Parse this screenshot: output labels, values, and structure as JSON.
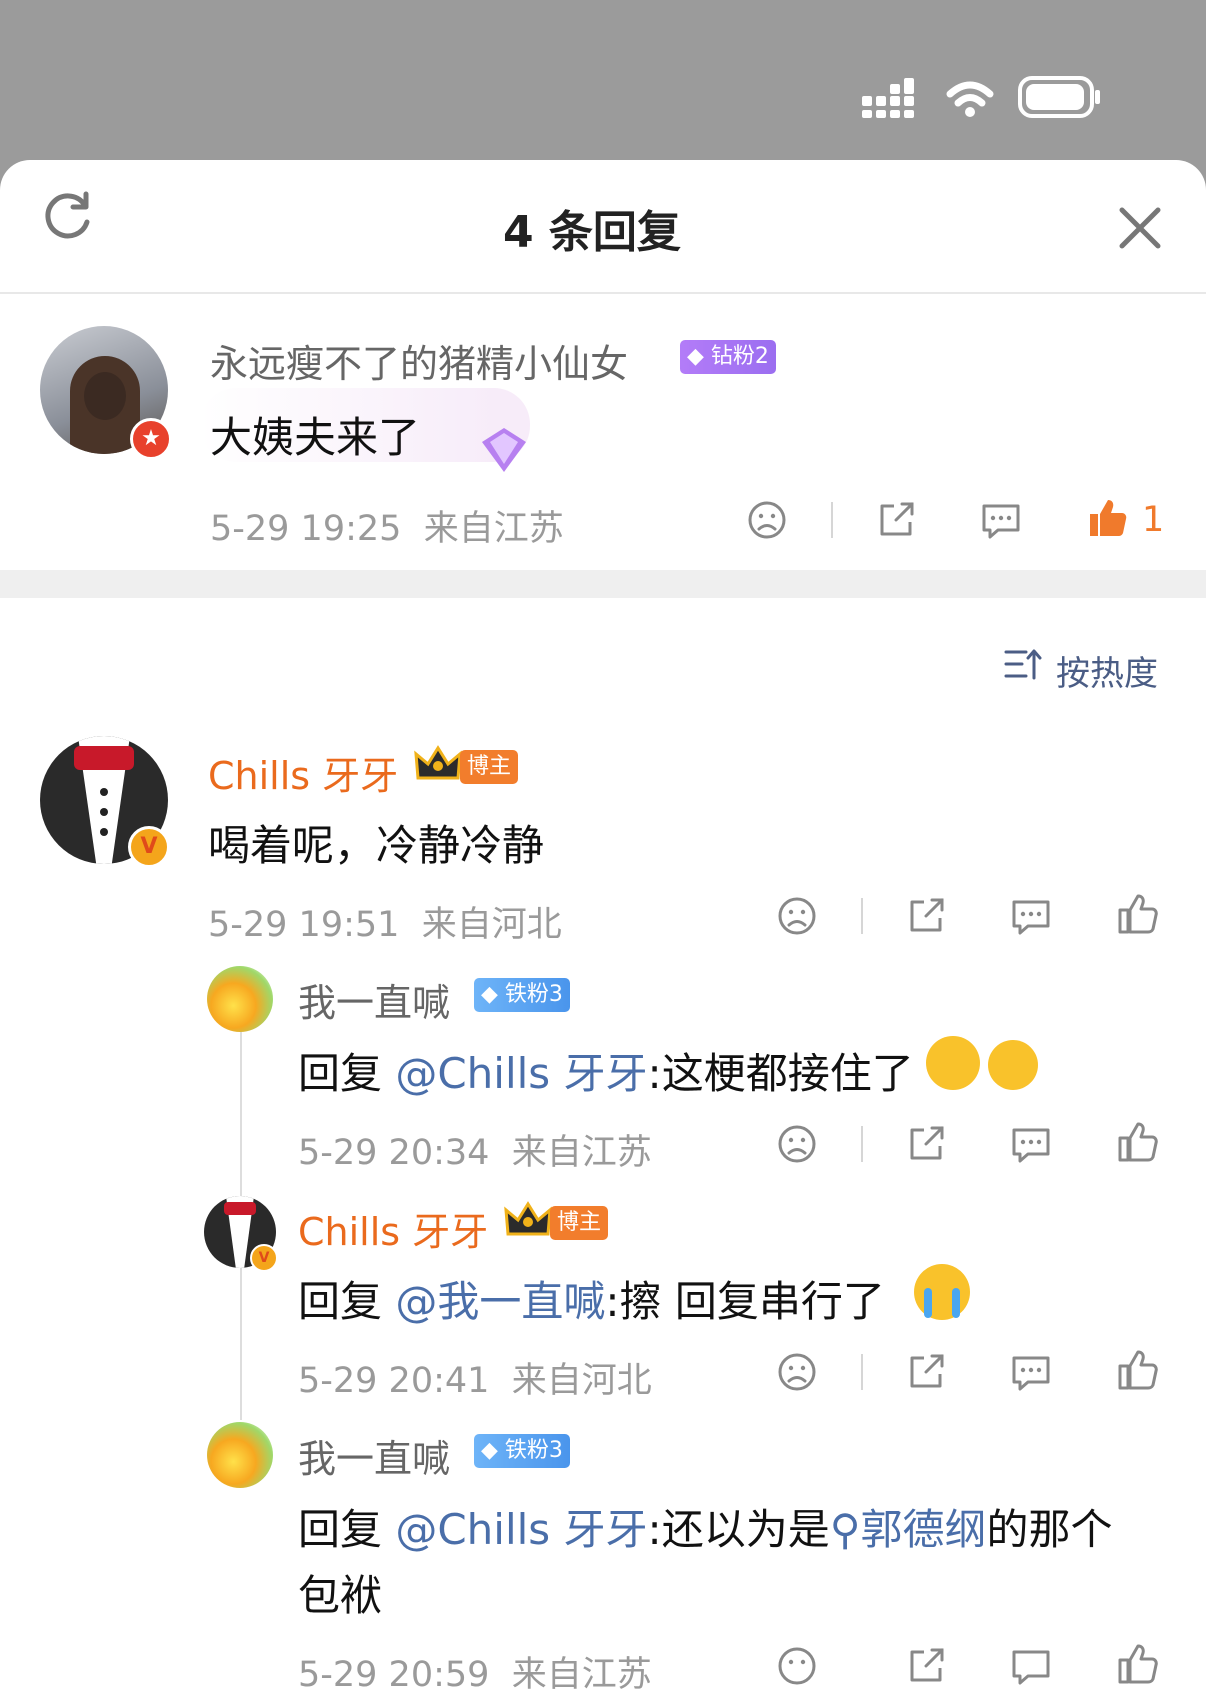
{
  "status_bar": {
    "signal_icon": "signal-icon",
    "wifi_icon": "wifi-icon",
    "battery_icon": "battery-icon"
  },
  "header": {
    "title": "4 条回复",
    "refresh_icon": "refresh-icon",
    "close_icon": "close-icon"
  },
  "main_comment": {
    "username": "永远瘦不了的猪精小仙女",
    "badge": "钻粉2",
    "text": "大姨夫来了",
    "time": "5-29 19:25",
    "location": "来自江苏",
    "like_count": "1"
  },
  "sort": {
    "label": "按热度"
  },
  "replies": [
    {
      "username": "Chills 牙牙",
      "badge": "博主",
      "text": "喝着呢，冷静冷静",
      "time": "5-29 19:51",
      "location": "来自河北"
    },
    {
      "username": "我一直喊",
      "badge": "铁粉3",
      "reply_prefix": "回复 ",
      "mention": "@Chills 牙牙",
      "text": ":这梗都接住了",
      "time": "5-29 20:34",
      "location": "来自江苏"
    },
    {
      "username": "Chills 牙牙",
      "badge": "博主",
      "reply_prefix": "回复 ",
      "mention": "@我一直喊",
      "text": ":擦 回复串行了",
      "time": "5-29 20:41",
      "location": "来自河北"
    },
    {
      "username": "我一直喊",
      "badge": "铁粉3",
      "reply_prefix": "回复 ",
      "mention": "@Chills 牙牙",
      "text": ":还以为是",
      "search_term": "郭德纲",
      "text_after": "的那个",
      "text_line2": "包袱",
      "time": "5-29 20:59",
      "location": "来自江苏"
    }
  ],
  "colors": {
    "accent_orange": "#ea6a1d",
    "link_blue": "#4a6ea9",
    "like_orange": "#f07a2c"
  }
}
